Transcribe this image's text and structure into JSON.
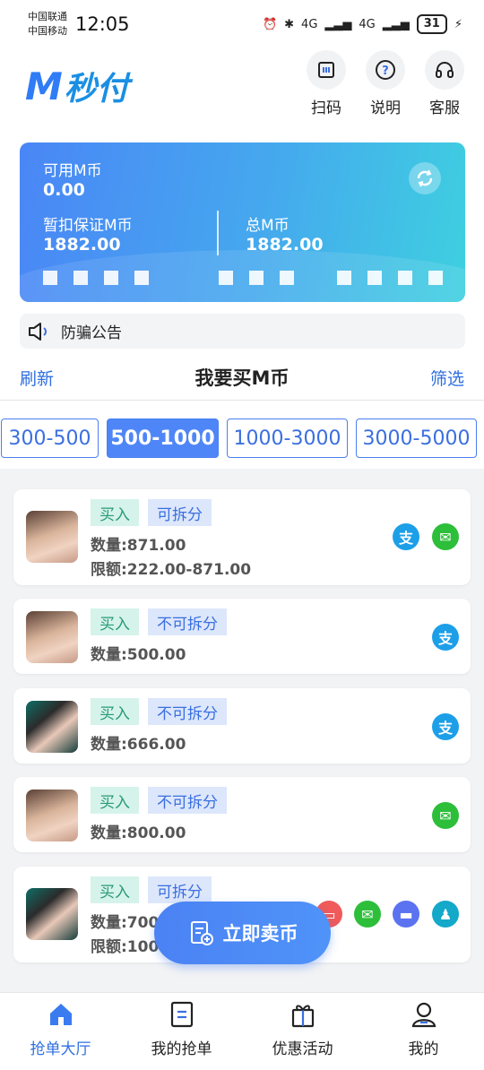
{
  "status_bar": {
    "carrier1": "中国联通",
    "carrier2": "中国移动",
    "time": "12:05",
    "battery": "31",
    "network1": "4G",
    "network2": "4G"
  },
  "header": {
    "logo_mark": "M",
    "logo_text": "秒付",
    "actions": [
      {
        "label": "扫码",
        "icon": "scan-icon"
      },
      {
        "label": "说明",
        "icon": "help-icon"
      },
      {
        "label": "客服",
        "icon": "headset-icon"
      }
    ]
  },
  "balance_card": {
    "available_label": "可用M币",
    "available_value": "0.00",
    "frozen_label": "暂扣保证M币",
    "frozen_value": "1882.00",
    "total_label": "总M币",
    "total_value": "1882.00"
  },
  "notice": {
    "label": "防骗公告"
  },
  "title_bar": {
    "left": "刷新",
    "title": "我要买M币",
    "right": "筛选"
  },
  "filters": [
    {
      "label": "300-500",
      "active": false
    },
    {
      "label": "500-1000",
      "active": true
    },
    {
      "label": "1000-3000",
      "active": false
    },
    {
      "label": "3000-5000",
      "active": false
    }
  ],
  "orders": [
    {
      "buy": "买入",
      "split": "可拆分",
      "amount": "数量:871.00",
      "limit": "限额:222.00-871.00",
      "payments": [
        "alipay",
        "wechat"
      ]
    },
    {
      "buy": "买入",
      "split": "不可拆分",
      "amount": "数量:500.00",
      "payments": [
        "alipay"
      ]
    },
    {
      "buy": "买入",
      "split": "不可拆分",
      "amount": "数量:666.00",
      "payments": [
        "alipay"
      ]
    },
    {
      "buy": "买入",
      "split": "不可拆分",
      "amount": "数量:800.00",
      "payments": [
        "wechat"
      ]
    },
    {
      "buy": "买入",
      "split": "可拆分",
      "amount": "数量:700",
      "limit": "限额:100",
      "payments": [
        "bank",
        "wechat",
        "card",
        "qq"
      ]
    }
  ],
  "sell_button": {
    "label": "立即卖币"
  },
  "tabbar": [
    {
      "label": "抢单大厅",
      "icon": "home-icon",
      "active": true
    },
    {
      "label": "我的抢单",
      "icon": "list-icon",
      "active": false
    },
    {
      "label": "优惠活动",
      "icon": "gift-icon",
      "active": false
    },
    {
      "label": "我的",
      "icon": "user-icon",
      "active": false
    }
  ],
  "colors": {
    "primary": "#4f86f7",
    "alipay": "#1d9fe8",
    "wechat": "#2dbe3a"
  }
}
